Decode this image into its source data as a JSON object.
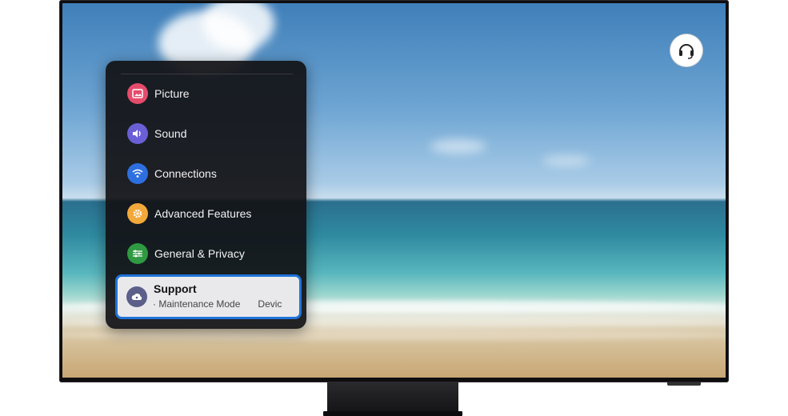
{
  "menu": {
    "items": [
      {
        "label": "Picture",
        "icon": "picture-icon",
        "color": "#e54b6b"
      },
      {
        "label": "Sound",
        "icon": "sound-icon",
        "color": "#6b5fd6"
      },
      {
        "label": "Connections",
        "icon": "wifi-icon",
        "color": "#2e6fe0"
      },
      {
        "label": "Advanced Features",
        "icon": "gear-icon",
        "color": "#f2a93b"
      },
      {
        "label": "General & Privacy",
        "icon": "sliders-icon",
        "color": "#2f9a41"
      }
    ],
    "selected": {
      "label": "Support",
      "icon": "cloud-support-icon",
      "color": "#5b5f8a",
      "sub_prefix": "·",
      "sub_item_1": "Maintenance Mode",
      "sub_item_2": "Devic"
    }
  },
  "top_right": {
    "icon": "headset-icon"
  },
  "colors": {
    "focus_border": "#1f73d8",
    "menu_bg": "#121216"
  }
}
